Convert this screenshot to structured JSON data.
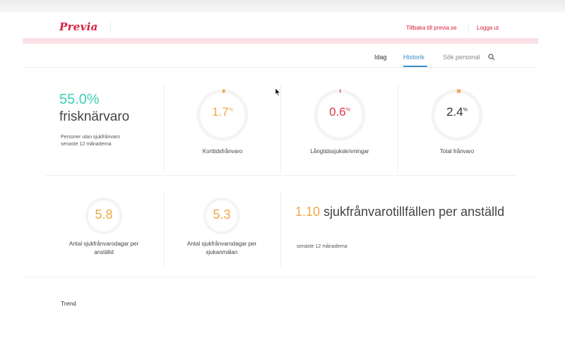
{
  "header": {
    "logo": "Previa",
    "back_link": "Tillbaka till previa.se",
    "logout_link": "Logga ut"
  },
  "nav": {
    "tabs": [
      {
        "label": "Idag",
        "active": false
      },
      {
        "label": "Historik",
        "active": true
      },
      {
        "label": "Sök personal",
        "active": false
      }
    ],
    "search_icon": "search-icon"
  },
  "summary": {
    "presence_percent": "55.0%",
    "presence_label": "frisknärvaro",
    "presence_sub_line1": "Personer utan sjukfrånvaro",
    "presence_sub_line2": "senaste 12 månaderna"
  },
  "rings": [
    {
      "value": "1.7",
      "unit": "%",
      "label": "Korttidsfrånvaro",
      "color": "#f0a84a",
      "fraction": 0.017
    },
    {
      "value": "0.6",
      "unit": "%",
      "label": "Långtidssjukskrivningar",
      "color": "#e0344e",
      "fraction": 0.006
    },
    {
      "value": "2.4",
      "unit": "%",
      "label": "Total frånvaro",
      "color": "#333333",
      "accent": "#f0a84a",
      "fraction": 0.024
    }
  ],
  "stats": [
    {
      "value": "5.8",
      "label_line1": "Antal sjukfrånvarodagar per",
      "label_line2": "anställd"
    },
    {
      "value": "5.3",
      "label_line1": "Antal sjukfrånvarodagar per",
      "label_line2": "sjukanmälan"
    }
  ],
  "incidents": {
    "value": "1.10",
    "label": "sjukfrånvarotillfällen per anställd",
    "sub": "senaste 12 månaderna"
  },
  "trend": {
    "title": "Trend"
  },
  "colors": {
    "brand_red": "#d6203c",
    "teal": "#3fcfb4",
    "orange": "#f0a84a",
    "tab_active": "#3a8ec8"
  }
}
